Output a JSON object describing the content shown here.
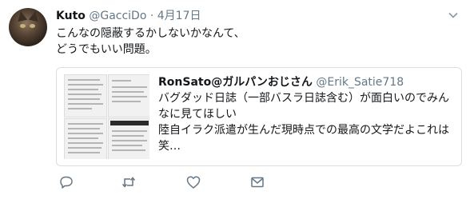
{
  "tweet": {
    "author_name": "Kuto",
    "author_handle": "@GacciDo",
    "separator": "·",
    "date": "4月17日",
    "text_line1": "こんなの隠蔽するかしないかなんて、",
    "text_line2": "どうでもいい問題。"
  },
  "quote": {
    "author_name": "RonSato@ガルパンおじさん",
    "author_handle": "@Erik_Satie718",
    "line1": "バグダッド日誌（一部バスラ日誌含む）が面白いのでみん",
    "line2": "なに見てほしい",
    "line3": "陸自イラク派遣が生んだ現時点での最高の文学だよこれは",
    "line4": "笑…"
  },
  "icons": {
    "menu": "chevron-down-icon",
    "reply": "reply-icon",
    "retweet": "retweet-icon",
    "like": "heart-icon",
    "message": "direct-message-icon"
  },
  "colors": {
    "text": "#14171a",
    "muted": "#657786",
    "border": "#d8dee3",
    "action": "#657786"
  }
}
